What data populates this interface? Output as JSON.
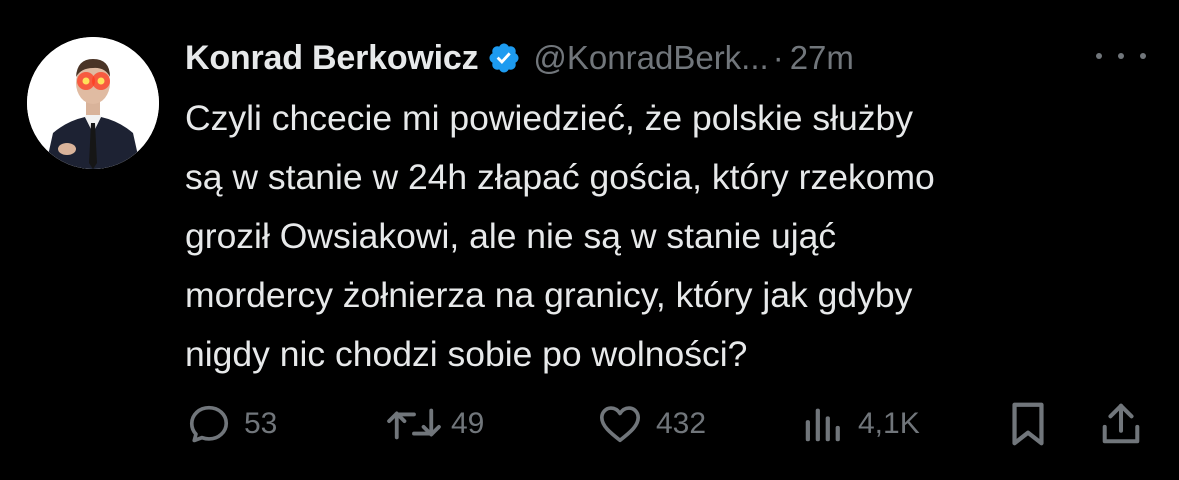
{
  "tweet": {
    "author": {
      "display_name": "Konrad Berkowicz",
      "handle": "@KonradBerk...",
      "verified": true,
      "verified_color": "#1d9bf0",
      "avatar_icon": "profile-photo"
    },
    "separator": "·",
    "time": "27m",
    "text_lines": [
      "Czyli chcecie mi powiedzieć, że polskie służby",
      "są w stanie w 24h złapać gościa, który rzekomo",
      "groził Owsiakowi, ale nie są w stanie ująć",
      "mordercy żołnierza na granicy, który jak gdyby",
      "nigdy nic chodzi sobie po wolności?"
    ],
    "actions": {
      "reply": {
        "icon": "reply-icon",
        "count": "53"
      },
      "retweet": {
        "icon": "retweet-icon",
        "count": "49"
      },
      "like": {
        "icon": "heart-icon",
        "count": "432"
      },
      "views": {
        "icon": "views-icon",
        "count": "4,1K"
      },
      "bookmark": {
        "icon": "bookmark-icon"
      },
      "share": {
        "icon": "share-icon"
      }
    }
  },
  "colors": {
    "background": "#000000",
    "primary_text": "#e7e9ea",
    "secondary_text": "#71767b"
  }
}
